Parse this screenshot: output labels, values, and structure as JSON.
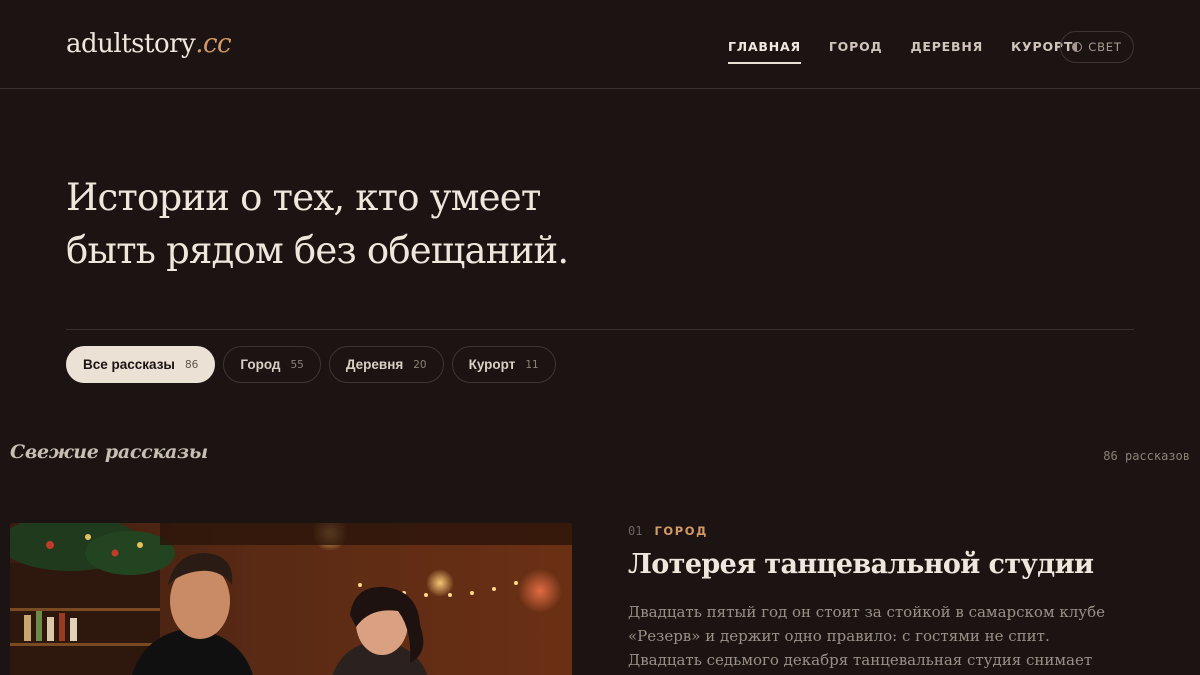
{
  "header": {
    "logo_main": "adultstory",
    "logo_tld": ".cc",
    "nav": [
      {
        "label": "ГЛАВНАЯ",
        "active": true
      },
      {
        "label": "ГОРОД",
        "active": false
      },
      {
        "label": "ДЕРЕВНЯ",
        "active": false
      },
      {
        "label": "КУРОРТ",
        "active": false
      }
    ],
    "theme_toggle": {
      "label": "СВЕТ",
      "icon": "contrast-half-icon"
    }
  },
  "hero": {
    "title_line1": "Истории о тех, кто умеет",
    "title_line2": "быть рядом без обещаний."
  },
  "filters": [
    {
      "label": "Все рассказы",
      "count": "86",
      "active": true
    },
    {
      "label": "Город",
      "count": "55",
      "active": false
    },
    {
      "label": "Деревня",
      "count": "20",
      "active": false
    },
    {
      "label": "Курорт",
      "count": "11",
      "active": false
    }
  ],
  "section": {
    "title": "Свежие рассказы",
    "count": "86 рассказов"
  },
  "stories": [
    {
      "index": "01",
      "category": "ГОРОД",
      "title": "Лотерея танцевальной студии",
      "excerpt": "Двадцать пятый год он стоит за стойкой в самарском клубе «Резерв» и держит одно правило: с гостями не спит. Двадцать седьмого декабря танцевальная студия снимает зал целиком,",
      "image": "bar-couple-photo"
    }
  ],
  "colors": {
    "background": "#1b1412",
    "accent": "#d59a63",
    "text": "#efe6dc",
    "muted": "#9c9086",
    "chip_active_bg": "#ebe1d5"
  }
}
